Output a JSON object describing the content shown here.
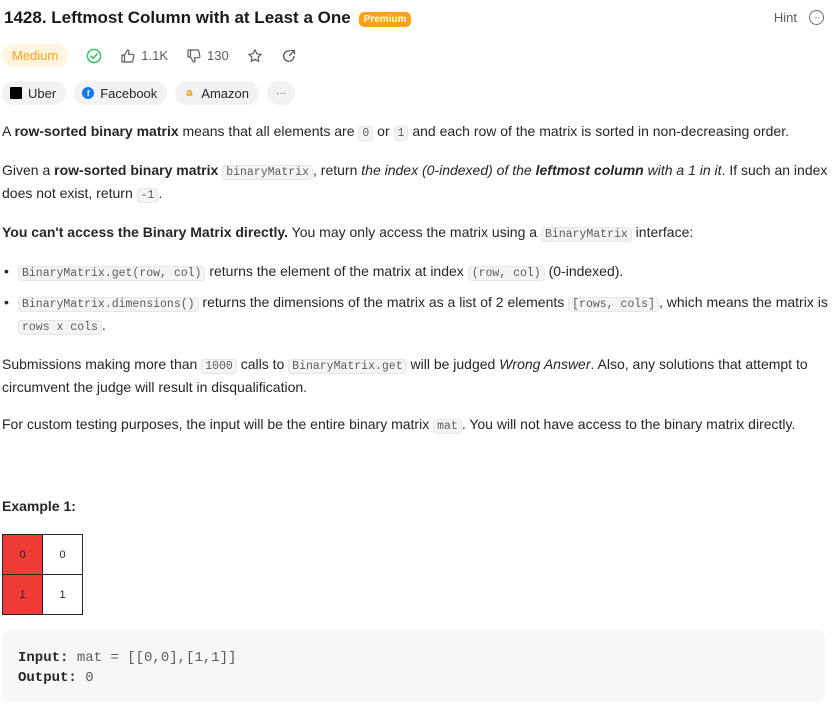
{
  "header": {
    "title": "1428. Leftmost Column with at Least a One",
    "premium_badge": "Premium",
    "hint_label": "Hint"
  },
  "meta": {
    "difficulty": "Medium",
    "likes": "1.1K",
    "dislikes": "130",
    "colors": {
      "difficulty": "#ffa116",
      "solved": "#2cbb5d",
      "premium": "#ffa116"
    }
  },
  "companies": [
    {
      "name": "Uber",
      "icon": "uber-logo"
    },
    {
      "name": "Facebook",
      "icon": "facebook-logo"
    },
    {
      "name": "Amazon",
      "icon": "amazon-logo"
    }
  ],
  "more_label": "···",
  "description": {
    "p1": {
      "a": "A ",
      "b": "row-sorted binary matrix",
      "c": " means that all elements are ",
      "code1": "0",
      "d": " or ",
      "code2": "1",
      "e": " and each row of the matrix is sorted in non-decreasing order."
    },
    "p2": {
      "a": "Given a ",
      "b": "row-sorted binary matrix",
      "code1": "binaryMatrix",
      "c": ", return ",
      "d": "the index (0-indexed) of the ",
      "e": "leftmost column",
      "f": " with a 1 in it",
      "g": ". If such an index does not exist, return ",
      "code2": "-1",
      "h": "."
    },
    "p3": {
      "a": "You can't access the Binary Matrix directly.",
      "b": " You may only access the matrix using a ",
      "code1": "BinaryMatrix",
      "c": " interface:"
    },
    "bullet1": {
      "code1": "BinaryMatrix.get(row, col)",
      "a": " returns the element of the matrix at index ",
      "code2": "(row, col)",
      "b": " (0-indexed)."
    },
    "bullet2": {
      "code1": "BinaryMatrix.dimensions()",
      "a": " returns the dimensions of the matrix as a list of 2 elements ",
      "code2": "[rows, cols]",
      "b": ", which means the matrix is ",
      "code3": "rows x cols",
      "c": "."
    },
    "p4": {
      "a": "Submissions making more than ",
      "code1": "1000",
      "b": " calls to ",
      "code2": "BinaryMatrix.get",
      "c": " will be judged ",
      "d": "Wrong Answer",
      "e": ". Also, any solutions that attempt to circumvent the judge will result in disqualification."
    },
    "p5": {
      "a": "For custom testing purposes, the input will be the entire binary matrix ",
      "code1": "mat",
      "b": ". You will not have access to the binary matrix directly."
    }
  },
  "example": {
    "title": "Example 1:",
    "matrix": [
      [
        "0",
        "0"
      ],
      [
        "1",
        "1"
      ]
    ],
    "input_label": "Input:",
    "input_value": " mat = [[0,0],[1,1]]",
    "output_label": "Output:",
    "output_value": " 0"
  }
}
